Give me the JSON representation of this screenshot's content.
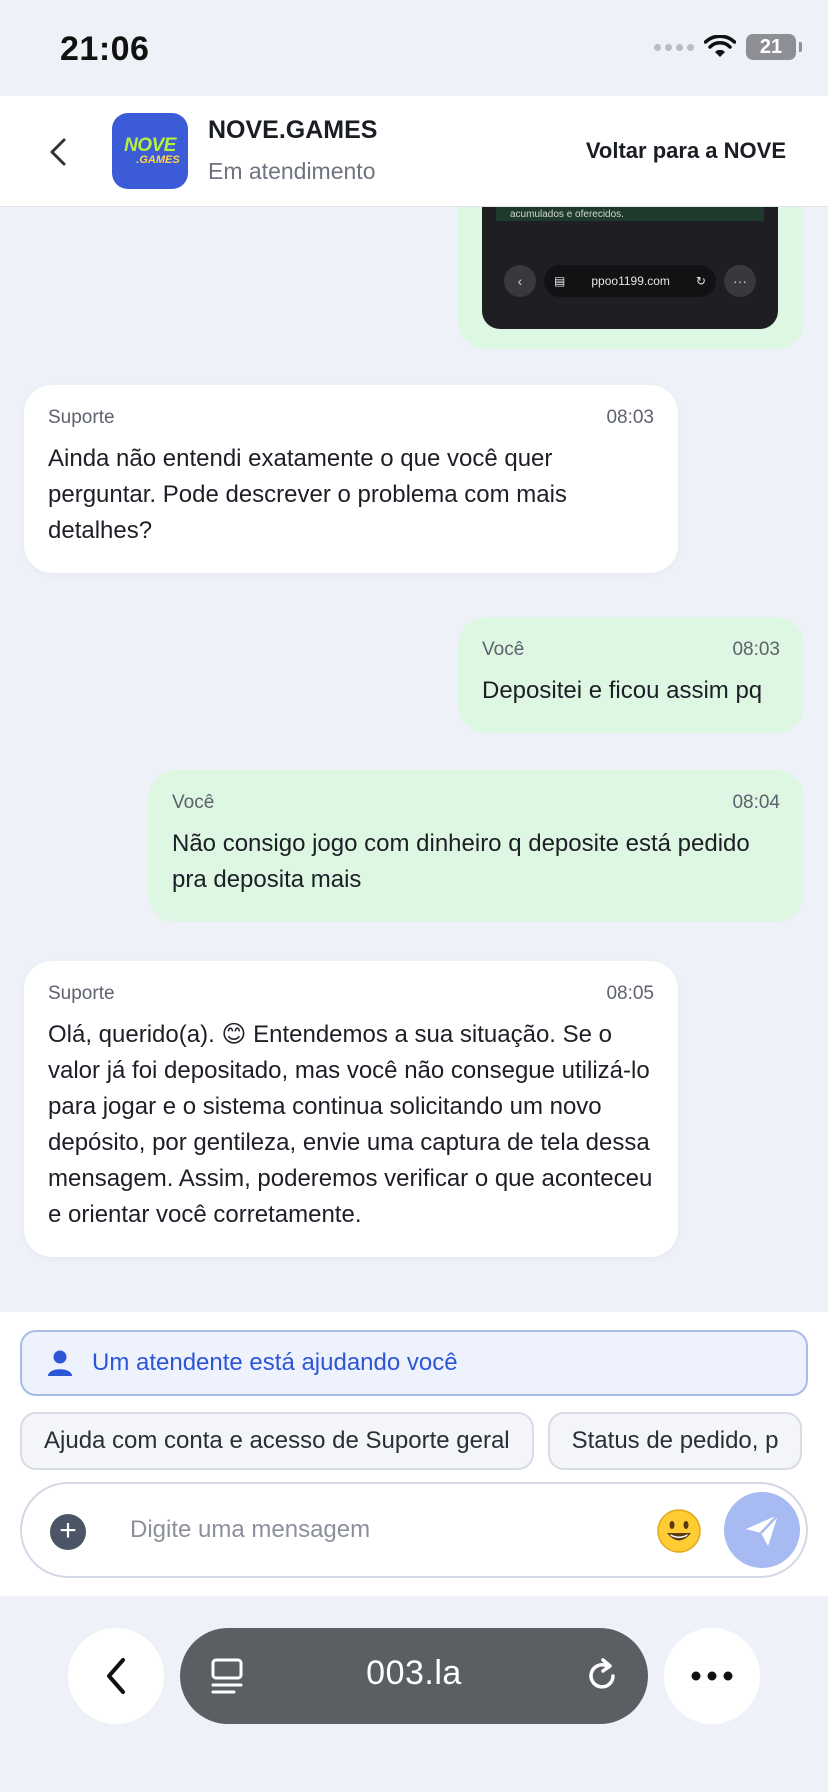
{
  "status_bar": {
    "time": "21:06",
    "battery": "21"
  },
  "header": {
    "logo_line1": "NOVE",
    "logo_line2": ".GAMES",
    "title": "NOVE.GAMES",
    "subtitle": "Em atendimento",
    "back_link": "Voltar para a NOVE"
  },
  "screenshot_preview": {
    "caption": "acumulados e oferecidos.",
    "url": "ppoo1199.com"
  },
  "messages": [
    {
      "sender": "Suporte",
      "time": "08:03",
      "text": "Ainda não entendi exatamente o que você quer perguntar. Pode descrever o problema com mais detalhes?"
    },
    {
      "sender": "Você",
      "time": "08:03",
      "text": "Depositei e ficou assim pq"
    },
    {
      "sender": "Você",
      "time": "08:04",
      "text": "Não consigo jogo com dinheiro q deposite está pedido pra deposita mais"
    },
    {
      "sender": "Suporte",
      "time": "08:05",
      "text": "Olá, querido(a). 😊 Entendemos a sua situação. Se o valor já foi depositado, mas você não consegue utilizá-lo para jogar e o sistema continua solicitando um novo depósito, por gentileza, envie uma captura de tela dessa mensagem. Assim, poderemos verificar o que aconteceu e orientar você corretamente."
    }
  ],
  "agent_banner": "Um atendente está ajudando você",
  "quick_replies": [
    "Ajuda com conta e acesso de Suporte geral",
    "Status de pedido, p"
  ],
  "composer": {
    "placeholder": "Digite uma mensagem"
  },
  "browser": {
    "url": "003.la"
  },
  "colors": {
    "accent_blue": "#2d56d6",
    "user_bubble": "#ddf7e2",
    "support_bubble": "#ffffff",
    "send_button": "#a8baf2"
  }
}
